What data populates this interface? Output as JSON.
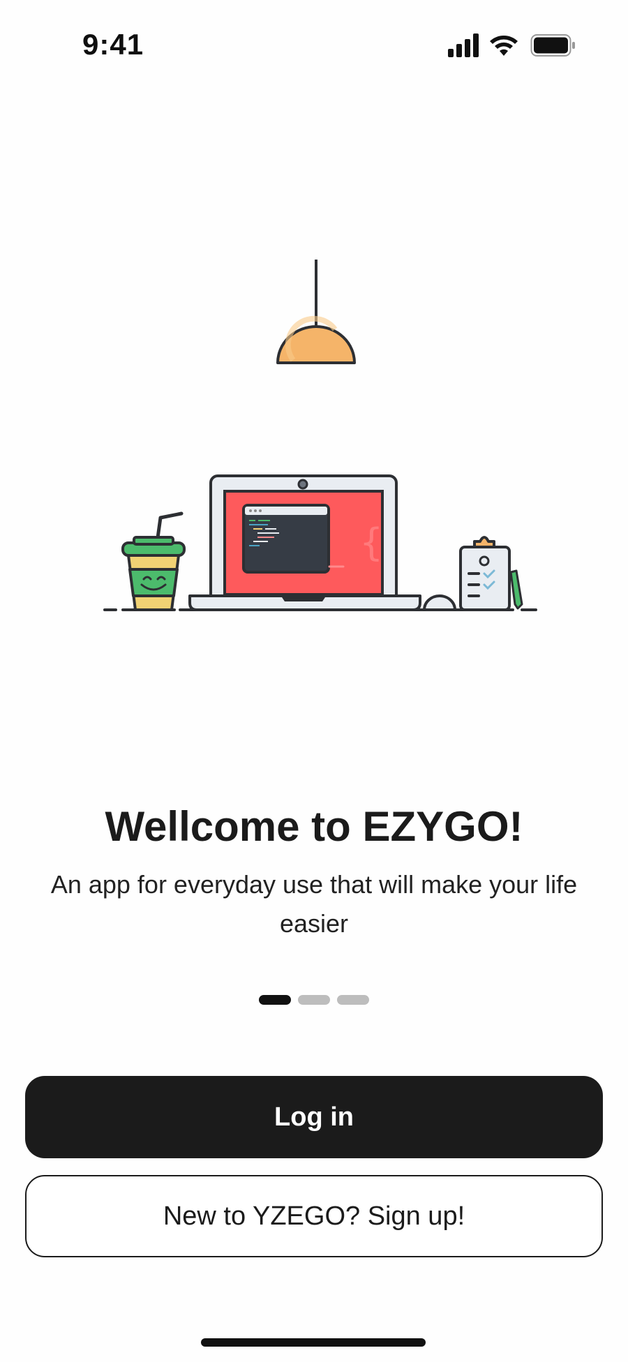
{
  "status_bar": {
    "time": "9:41",
    "icons": [
      "cellular-signal-icon",
      "wifi-icon",
      "battery-icon"
    ]
  },
  "illustration": {
    "name": "workspace-illustration",
    "elements": [
      "hanging-lamp",
      "coffee-cup",
      "laptop",
      "code-window",
      "mouse",
      "clipboard",
      "pen"
    ]
  },
  "onboarding": {
    "title": "Wellcome to EZYGO!",
    "subtitle": "An app for everyday use that will make your life easier",
    "pager": {
      "total": 3,
      "active_index": 0
    }
  },
  "actions": {
    "login_label": "Log in",
    "signup_label": "New to YZEGO? Sign up!"
  },
  "colors": {
    "primary": "#1b1b1b",
    "lamp": "#f5b469",
    "screen": "#fe5a5c",
    "cup_green": "#4cbb6c",
    "cup_yellow": "#f1d274",
    "code_bg": "#363c45"
  }
}
